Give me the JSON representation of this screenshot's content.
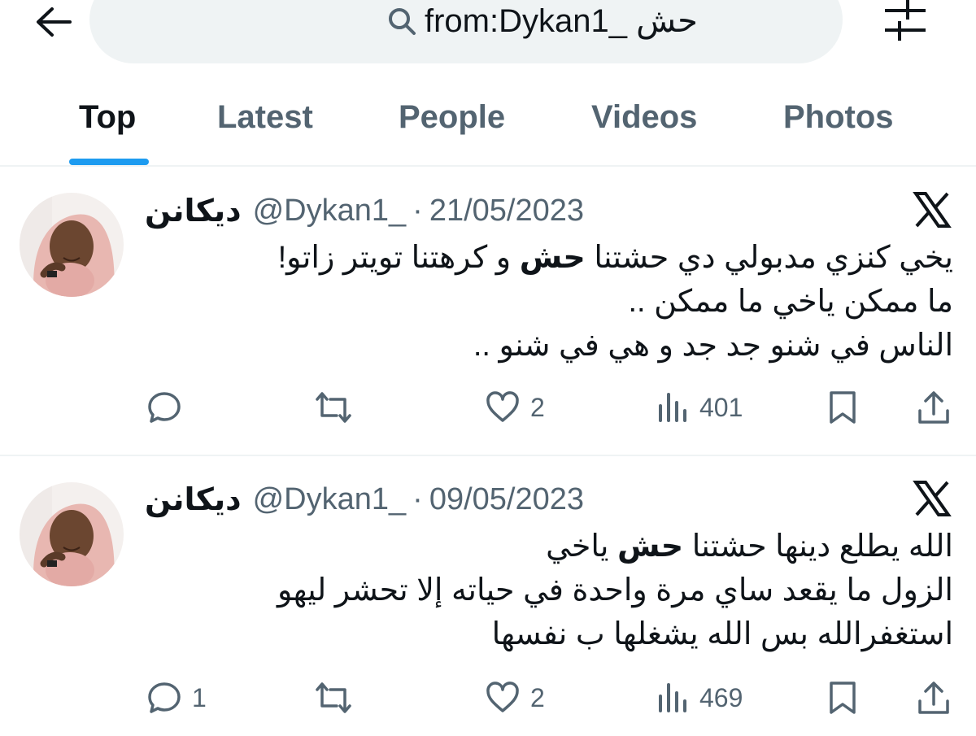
{
  "header": {
    "back_icon": "arrow-left-icon",
    "search_icon": "search-icon",
    "search_query": "from:Dykan1_ حش",
    "filter_icon": "sliders-icon"
  },
  "tabs": [
    {
      "label": "Top",
      "active": true
    },
    {
      "label": "Latest",
      "active": false
    },
    {
      "label": "People",
      "active": false
    },
    {
      "label": "Videos",
      "active": false
    },
    {
      "label": "Photos",
      "active": false
    }
  ],
  "colors": {
    "accent": "#1d9bf0",
    "text_primary": "#0f1419",
    "text_secondary": "#536471",
    "search_bg": "#eff3f4",
    "divider": "#eff3f4"
  },
  "tweets": [
    {
      "display_name": "ديكانن",
      "handle": "@Dykan1_",
      "separator": "·",
      "date": "21/05/2023",
      "lines": [
        {
          "before": "يخي كنزي مدبولي دي حشتنا ",
          "bold": "حش",
          "after": " و كرهتنا تويتر زاتو!"
        },
        {
          "before": "ما ممكن ياخي ما ممكن ..",
          "bold": "",
          "after": ""
        },
        {
          "before": "الناس في شنو جد جد و هي في شنو ..",
          "bold": "",
          "after": ""
        }
      ],
      "replies": "",
      "retweets": "",
      "likes": "2",
      "views": "401"
    },
    {
      "display_name": "ديكانن",
      "handle": "@Dykan1_",
      "separator": "·",
      "date": "09/05/2023",
      "lines": [
        {
          "before": "الله يطلع دينها حشتنا ",
          "bold": "حش",
          "after": " ياخي"
        },
        {
          "before": "الزول ما يقعد ساي مرة واحدة في حياته إلا تحشر ليهو",
          "bold": "",
          "after": ""
        },
        {
          "before": "استغفرالله بس الله يشغلها ب نفسها",
          "bold": "",
          "after": ""
        }
      ],
      "replies": "1",
      "retweets": "",
      "likes": "2",
      "views": "469"
    }
  ],
  "action_icons": [
    "reply-icon",
    "retweet-icon",
    "like-icon",
    "views-icon",
    "bookmark-icon",
    "share-icon"
  ]
}
